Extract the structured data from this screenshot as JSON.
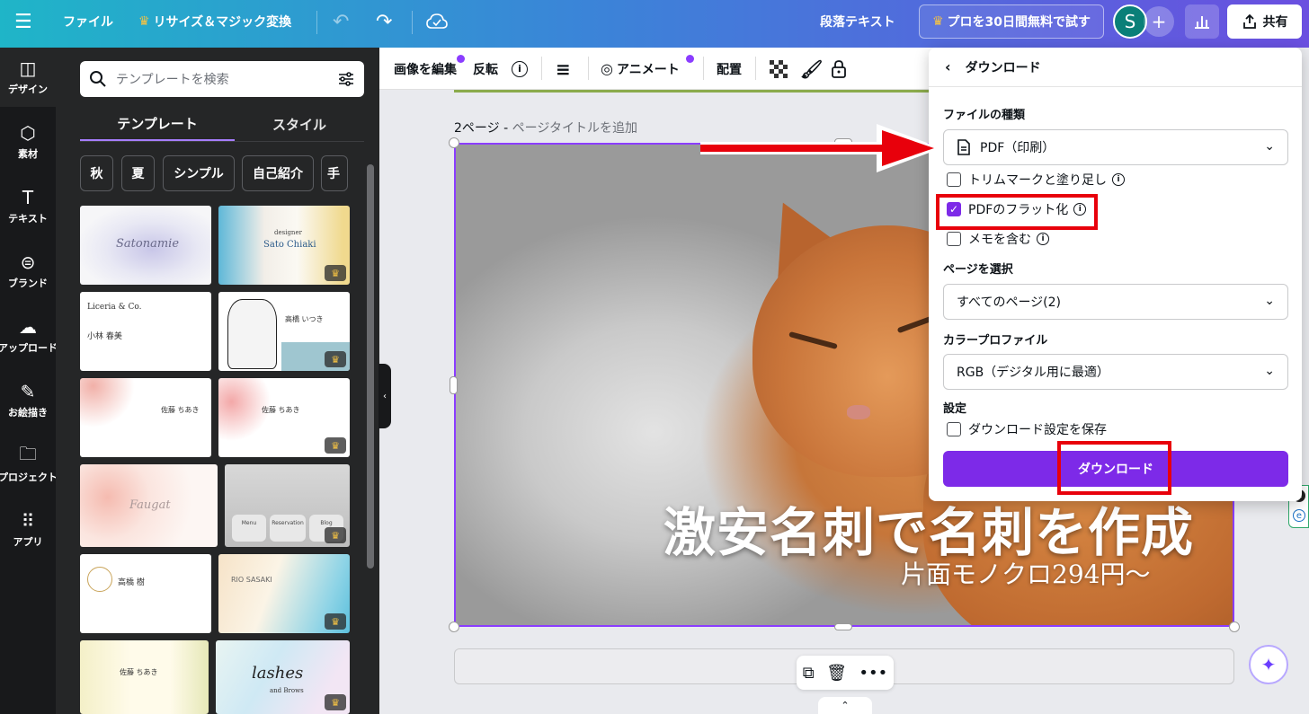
{
  "topbar": {
    "file_menu": "ファイル",
    "resize": "リサイズ＆マジック変換",
    "doc_type": "段落テキスト",
    "pro_trial": "プロを30日間無料で試す",
    "avatar_initial": "S",
    "share": "共有"
  },
  "rail": {
    "items": [
      {
        "label": "デザイン",
        "icon": "layout-icon"
      },
      {
        "label": "素材",
        "icon": "shapes-icon"
      },
      {
        "label": "テキスト",
        "icon": "text-icon"
      },
      {
        "label": "ブランド",
        "icon": "brand-icon"
      },
      {
        "label": "アップロード",
        "icon": "upload-cloud-icon"
      },
      {
        "label": "お絵描き",
        "icon": "draw-icon"
      },
      {
        "label": "プロジェクト",
        "icon": "folder-icon"
      },
      {
        "label": "アプリ",
        "icon": "apps-grid-icon"
      }
    ]
  },
  "panel": {
    "search_placeholder": "テンプレートを検索",
    "tab_templates": "テンプレート",
    "tab_styles": "スタイル",
    "chips": [
      "秋",
      "夏",
      "シンプル",
      "自己紹介",
      "手"
    ],
    "cards": {
      "c1": "Satonamie",
      "c2_role": "designer",
      "c2_name": "Sato Chiaki",
      "c3_brand": "Liceria & Co.",
      "c3_name": "小林 春美",
      "c4_name": "高橋 いつき",
      "c5_name": "佐藤 ちあき",
      "c6_name": "佐藤 ちあき",
      "c7_script": "Faugat",
      "c8_tabs": [
        "Menu",
        "Reservation",
        "Blog"
      ],
      "c9_name": "高橋 樹",
      "c10_name": "RIO SASAKI",
      "c11_name": "佐藤 ちあき",
      "c12_script": "lashes",
      "c12_sub": "and Brows"
    }
  },
  "toolbar": {
    "edit_image": "画像を編集",
    "flip": "反転",
    "animate": "アニメート",
    "position": "配置"
  },
  "canvas": {
    "page_label": "2ページ - ",
    "page_title_placeholder": "ページタイトルを追加",
    "headline": "激安名刺で名刺を作成",
    "subline": "片面モノクロ294円〜"
  },
  "download": {
    "title": "ダウンロード",
    "file_type_label": "ファイルの種類",
    "file_type_value": "PDF（印刷）",
    "opt_trim": "トリムマークと塗り足し",
    "opt_flatten": "PDFのフラット化",
    "opt_notes": "メモを含む",
    "pages_label": "ページを選択",
    "pages_value": "すべてのページ(2)",
    "color_label": "カラープロファイル",
    "color_value": "RGB（デジタル用に最適）",
    "settings_label": "設定",
    "save_settings": "ダウンロード設定を保存",
    "button": "ダウンロード"
  },
  "colors": {
    "accent": "#7d2ae8",
    "highlight": "#e8000b"
  }
}
